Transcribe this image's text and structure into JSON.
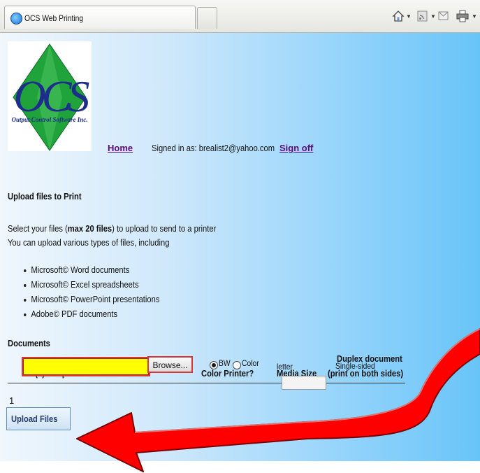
{
  "browser": {
    "tab_title": "OCS Web Printing",
    "toolbar_icons": [
      "home-icon",
      "feeds-icon",
      "read-mail-icon",
      "print-icon"
    ]
  },
  "logo": {
    "letters": "OCS",
    "company": "Output Control Software Inc."
  },
  "nav": {
    "home": "Home",
    "signed_in_prefix": "Signed in as: brealist2@yahoo.com",
    "sign_off": "Sign off"
  },
  "upload": {
    "heading": "Upload files to Print",
    "intro_prefix": "Select your files (",
    "intro_bold": "max 20 files",
    "intro_suffix": ") to upload to send to a printer",
    "intro_line2": "You can upload various types of files, including",
    "file_types": [
      "Microsoft© Word documents",
      "Microsoft© Excel spreadsheets",
      "Microsoft© PowerPoint presentations",
      "Adobe© PDF documents"
    ]
  },
  "documents": {
    "heading": "Documents",
    "columns": {
      "files": "File(s) to Upload",
      "color_printer": "Color Printer?",
      "media_size": "Media Size",
      "duplex_line1": "Duplex document",
      "duplex_line2": "(print on both sides)"
    },
    "row": {
      "index": "1",
      "file_value": "",
      "browse": "Browse...",
      "bw_label": "BW",
      "color_label": "Color",
      "selected": "BW",
      "media": "letter",
      "duplex": "Single-sided"
    }
  },
  "actions": {
    "upload_files": "Upload Files"
  },
  "colors": {
    "highlight_fill": "#ffff00",
    "highlight_border": "#d93636",
    "arrow": "#ff0000",
    "link": "#5a0a78",
    "logo_green": "#1fa33a",
    "logo_blue": "#1c2d8c"
  }
}
